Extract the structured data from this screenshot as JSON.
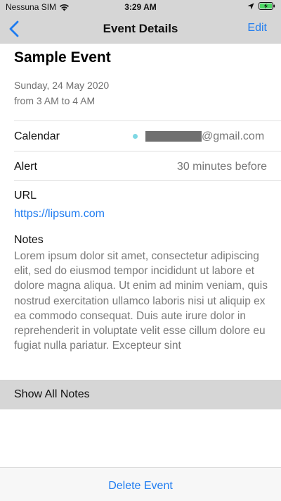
{
  "status_bar": {
    "carrier": "Nessuna SIM",
    "time": "3:29 AM",
    "icons": [
      "wifi-icon",
      "location-arrow-icon",
      "battery-charging-icon"
    ],
    "battery_color": "#4cd964"
  },
  "nav": {
    "title": "Event Details",
    "edit_label": "Edit",
    "back_icon": "chevron-left-icon",
    "accent_color": "#1f7cf0"
  },
  "event": {
    "title": "Sample Event",
    "date": "Sunday, 24 May 2020",
    "time_range": "from 3 AM to 4 AM"
  },
  "details": {
    "calendar_label": "Calendar",
    "calendar_value": "@gmail.com",
    "calendar_color": "#7fd8e4",
    "alert_label": "Alert",
    "alert_value": "30 minutes before",
    "url_label": "URL",
    "url_value": "https://lipsum.com",
    "notes_label": "Notes",
    "notes_text": "Lorem ipsum dolor sit amet, consectetur adipiscing elit, sed do eiusmod tempor incididunt ut labore et dolore magna aliqua. Ut enim ad minim veniam, quis nostrud exercitation ullamco laboris nisi ut aliquip ex ea commodo consequat. Duis aute irure dolor in reprehenderit in voluptate velit esse cillum dolore eu fugiat nulla pariatur. Excepteur sint"
  },
  "actions": {
    "show_all_notes": "Show All Notes",
    "delete_event": "Delete Event"
  }
}
